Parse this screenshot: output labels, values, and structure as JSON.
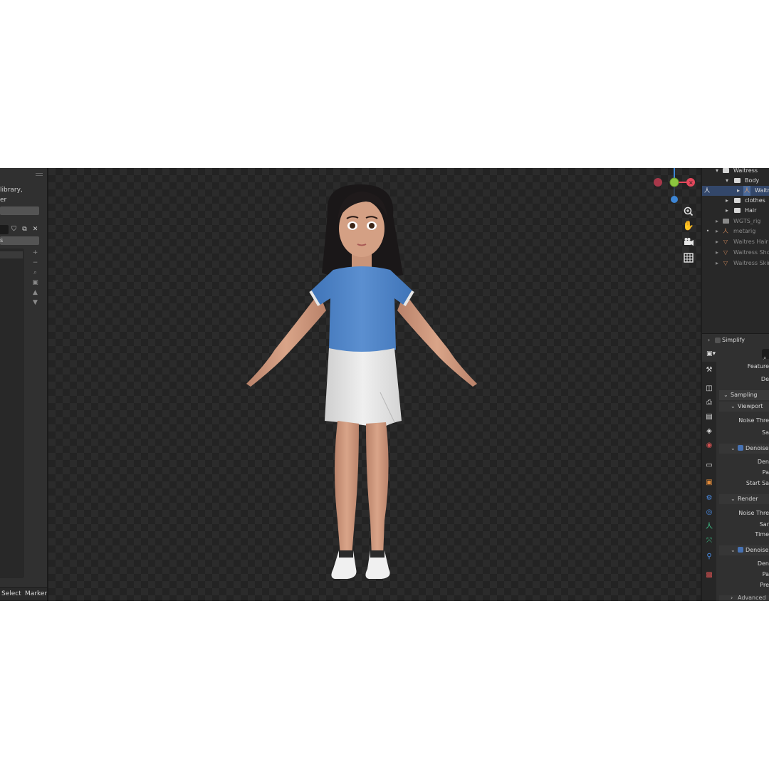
{
  "left_panel": {
    "text_line1": "library,",
    "text_line2": "er",
    "list_label": "s",
    "footer": {
      "select": "Select",
      "marker": "Marker"
    }
  },
  "viewport": {
    "gizmo": {
      "x_color": "#e5485c",
      "y_color": "#8cc63f",
      "z_color": "#3d86d6"
    },
    "nav_icons": [
      "zoom-icon",
      "hand-pan-icon",
      "camera-icon",
      "grid-icon"
    ]
  },
  "outliner": {
    "rows": [
      {
        "label": "Waitress",
        "icon": "collection-icon"
      },
      {
        "label": "Body",
        "icon": "collection-icon"
      },
      {
        "label": "Waitr",
        "icon": "armature-icon"
      },
      {
        "label": "clothes",
        "icon": "collection-icon"
      },
      {
        "label": "Hair",
        "icon": "collection-icon"
      },
      {
        "label": "WGTS_rig",
        "icon": "collection-icon"
      },
      {
        "label": "metarig",
        "icon": "armature-icon"
      },
      {
        "label": "Waitres Hair",
        "icon": "mesh-icon"
      },
      {
        "label": "Waitress Shoe",
        "icon": "mesh-icon"
      },
      {
        "label": "Waitress Skin",
        "icon": "mesh-icon"
      }
    ]
  },
  "properties": {
    "simplify": "Simplify",
    "feature": "Feature",
    "de": "De",
    "sampling": "Sampling",
    "viewport": "Viewport",
    "noise_thre": "Noise Thre",
    "sa": "Sa",
    "denoise": "Denoise",
    "den": "Den",
    "pa": "Pa",
    "start_sa": "Start Sa",
    "render": "Render",
    "noise_thre_2": "Noise Thre",
    "sar": "Sar",
    "time": "Time",
    "denoise_2": "Denoise",
    "den_2": "Den",
    "pa_2": "Pa",
    "pre": "Pre",
    "advanced": "Advanced"
  },
  "colors": {
    "accent": "#4772b3",
    "selection": "#33476a"
  }
}
